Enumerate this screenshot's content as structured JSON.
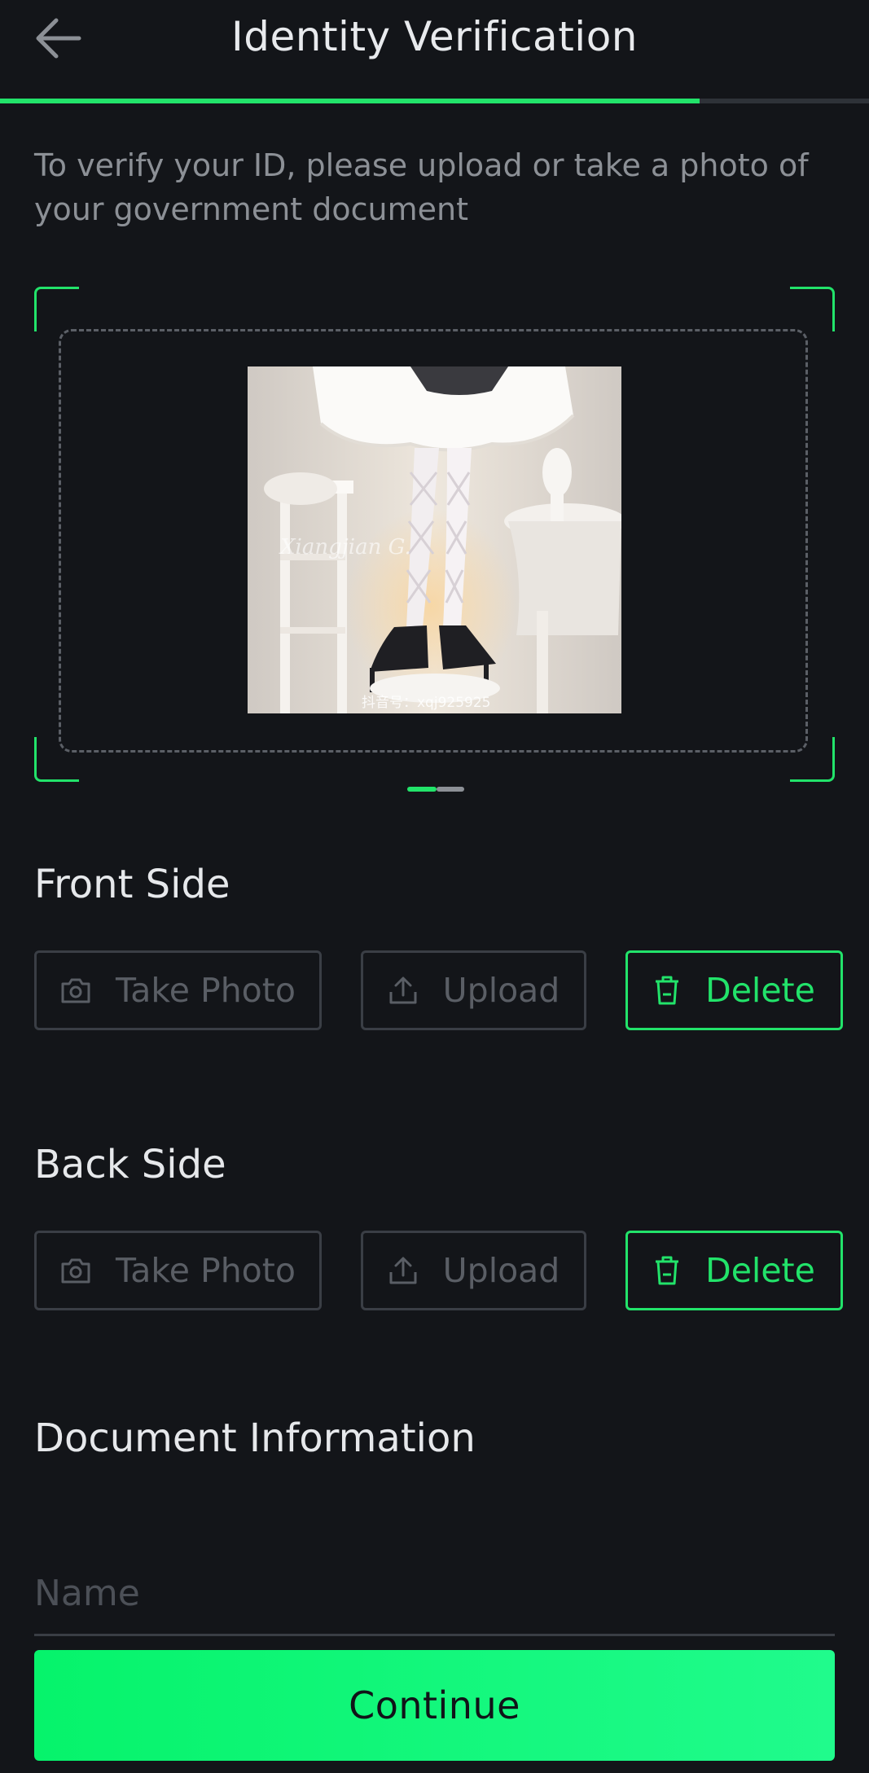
{
  "header": {
    "title": "Identity Verification",
    "progress": 0.805
  },
  "instructions": "To verify your ID, please upload or take a photo of your government document",
  "preview": {
    "watermark": "Xiangjian G.",
    "caption": "抖音号：xqj925925"
  },
  "front": {
    "title": "Front Side",
    "take_photo": "Take Photo",
    "upload": "Upload",
    "delete": "Delete"
  },
  "back": {
    "title": "Back Side",
    "take_photo": "Take Photo",
    "upload": "Upload",
    "delete": "Delete"
  },
  "document": {
    "title": "Document Information",
    "name_placeholder": "Name"
  },
  "continue_label": "Continue",
  "colors": {
    "accent": "#22E36A",
    "background": "#131519"
  }
}
